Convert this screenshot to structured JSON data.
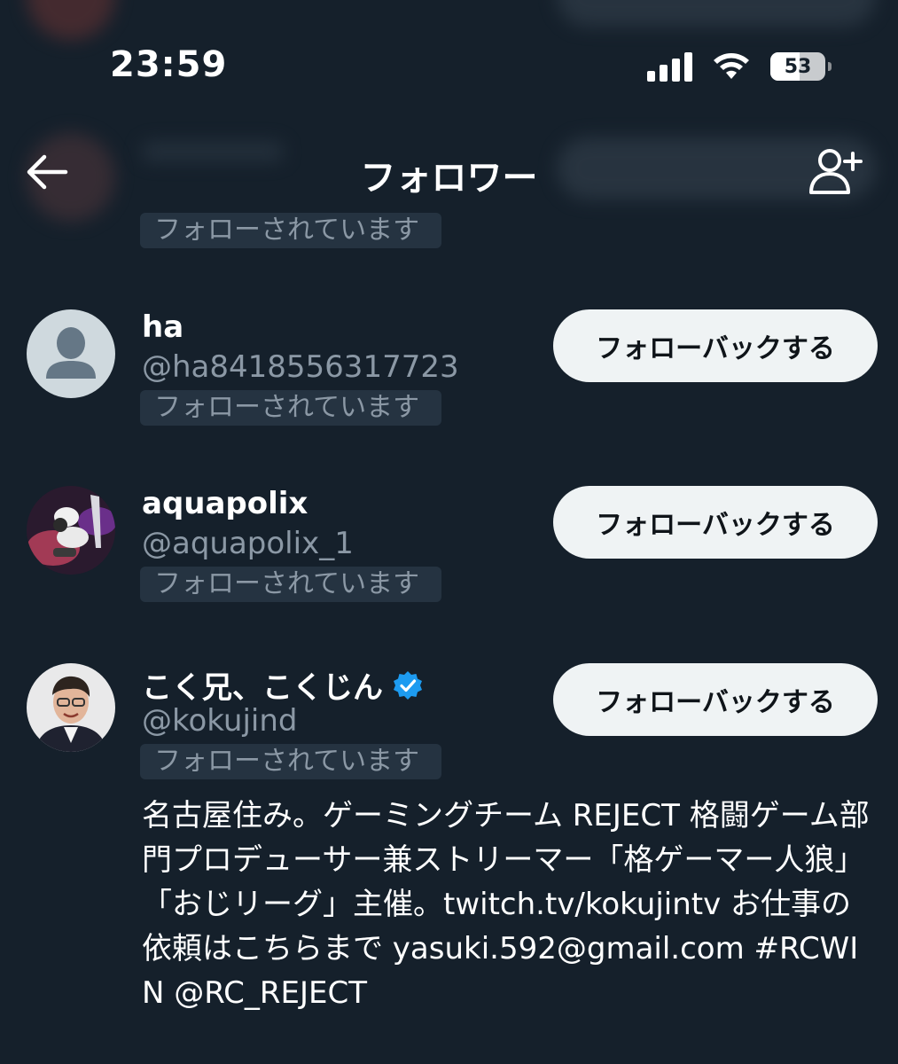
{
  "status_bar": {
    "time": "23:59",
    "battery_level": 53,
    "battery_label": "53"
  },
  "header": {
    "title": "フォロワー",
    "back_icon": "arrow-left-icon",
    "action_icon": "add-user-icon"
  },
  "partial_item": {
    "follows_you": "フォローされています"
  },
  "followers": [
    {
      "name": "ha",
      "handle": "@ha8418556317723",
      "follows_you": "フォローされています",
      "button": "フォローバックする",
      "avatar": "default-avatar",
      "verified": false
    },
    {
      "name": "aquapolix",
      "handle": "@aquapolix_1",
      "follows_you": "フォローされています",
      "button": "フォローバックする",
      "avatar": "photo-avatar",
      "verified": false
    },
    {
      "name": "こく兄、こくじん",
      "handle": "@kokujind",
      "follows_you": "フォローされています",
      "button": "フォローバックする",
      "avatar": "photo-avatar",
      "verified": true,
      "bio": "名古屋住み。ゲーミングチーム REJECT 格闘ゲーム部門プロデューサー兼ストリーマー「格ゲーマー人狼」「おじリーグ」主催。twitch.tv/kokujintv お仕事の依頼はこちらまで yasuki.592@gmail.com #RCWIN @RC_REJECT"
    }
  ],
  "colors": {
    "background": "#15202b",
    "badge_bg": "#253341",
    "secondary_text": "#8b98a5",
    "button_bg": "#eff3f4",
    "verified": "#1d9bf0"
  }
}
